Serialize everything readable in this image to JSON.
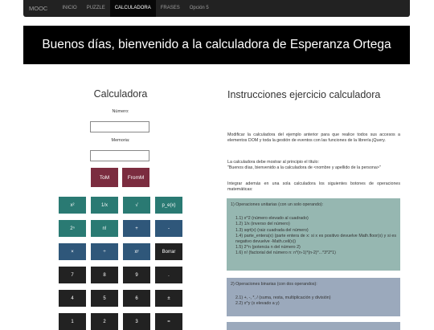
{
  "nav": {
    "brand": "MOOC",
    "items": [
      {
        "label": "INICIO",
        "active": false
      },
      {
        "label": "PUZZLE",
        "active": false
      },
      {
        "label": "CALCULADORA",
        "active": true
      },
      {
        "label": "FRASES",
        "active": false
      },
      {
        "label": "Opción 5",
        "active": false
      }
    ]
  },
  "banner": {
    "text": "Buenos días, bienvenido a la calculadora de Esperanza Ortega"
  },
  "calculator": {
    "title": "Calculadora",
    "numero_label": "Número:",
    "numero_value": "",
    "memoria_label": "Memoria:",
    "memoria_value": "",
    "tom_label": "ToM",
    "fromm_label": "FromM",
    "keys": [
      [
        "x²",
        "1/x",
        "√",
        "p_e(x)"
      ],
      [
        "2ⁿ",
        "n!",
        "+",
        "-"
      ],
      [
        "×",
        "÷",
        "xʸ",
        "Borrar"
      ],
      [
        "7",
        "8",
        "9",
        "."
      ],
      [
        "4",
        "5",
        "6",
        "±"
      ],
      [
        "1",
        "2",
        "3",
        "="
      ]
    ]
  },
  "instructions": {
    "title": "Instrucciones ejercicio calculadora",
    "p1": "Modificar la calculadora del ejemplo anterior para que realice todos sus accesos a elementos DOM y toda la gestión de eventos con las funciones de la librería jQuery.",
    "p2a": "La calculadora debe mostrar al principio el título:",
    "p2b": "\"Buenos días, bienvenido a la calculadora de <nombre y apellido de la persona>\"",
    "p3": "Integrar además en una sola calculadora los siguientes botones de operaciones matemáticas:",
    "box1": {
      "title": "1) Operaciones unitarias (con un solo operando):",
      "items": [
        "1.1) x^2 (número elevado al cuadrado)",
        "1.2) 1/x (inverso del número)",
        "1.3) sqrt(x) (raiz cuadrada del número)",
        "1.4) parte_entera(x) (parte entera de x: si x es positivo devuelve Math.floor(x) y si es negativo devuelve -Math.ceil(x))",
        "1.5) 2^n (potencia n del número 2)",
        "1.6) n! (factorial del número n: n*(n-1)*(n-2)*...*3*2*1)"
      ]
    },
    "box2": {
      "title": "2) Operaciones binarias (con dos operandos):",
      "items": [
        "2.1) +, -, *, / (suma, resta, multiplicación y división)",
        "2.2) x^y (x elevado a y)"
      ]
    }
  },
  "colors": {
    "teal_key": "#2a7a73",
    "blue_key": "#2f577a",
    "dark_key": "#222222",
    "memory_key": "#7b2c3f"
  }
}
